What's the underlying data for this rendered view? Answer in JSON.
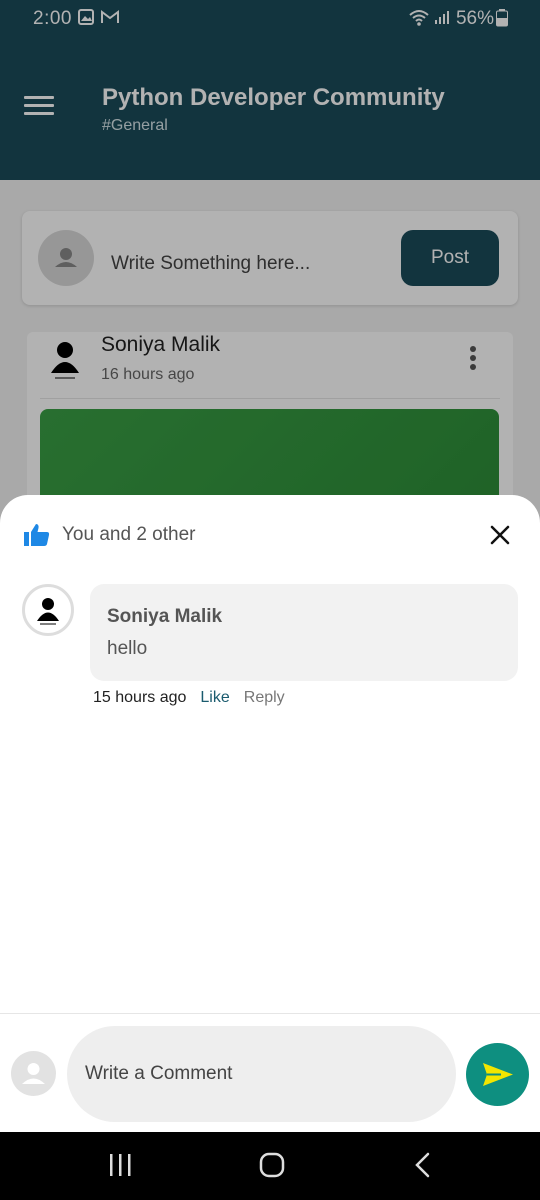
{
  "status_bar": {
    "time": "2:00",
    "battery": "56%"
  },
  "app_bar": {
    "title": "Python Developer Community",
    "subtitle": "#General",
    "color": "#1a4b5a"
  },
  "composer": {
    "placeholder": "Write Something here...",
    "post_label": "Post"
  },
  "post": {
    "author": "Soniya Malik",
    "time": "16 hours ago"
  },
  "likes_sheet": {
    "summary": "You and 2 other"
  },
  "comments": [
    {
      "author": "Soniya Malik",
      "text": "hello",
      "time": "15 hours ago",
      "like_label": "Like",
      "reply_label": "Reply"
    }
  ],
  "comment_input": {
    "placeholder": "Write a Comment"
  },
  "colors": {
    "accent": "#0e8f80",
    "like_blue": "#1e88e5"
  }
}
